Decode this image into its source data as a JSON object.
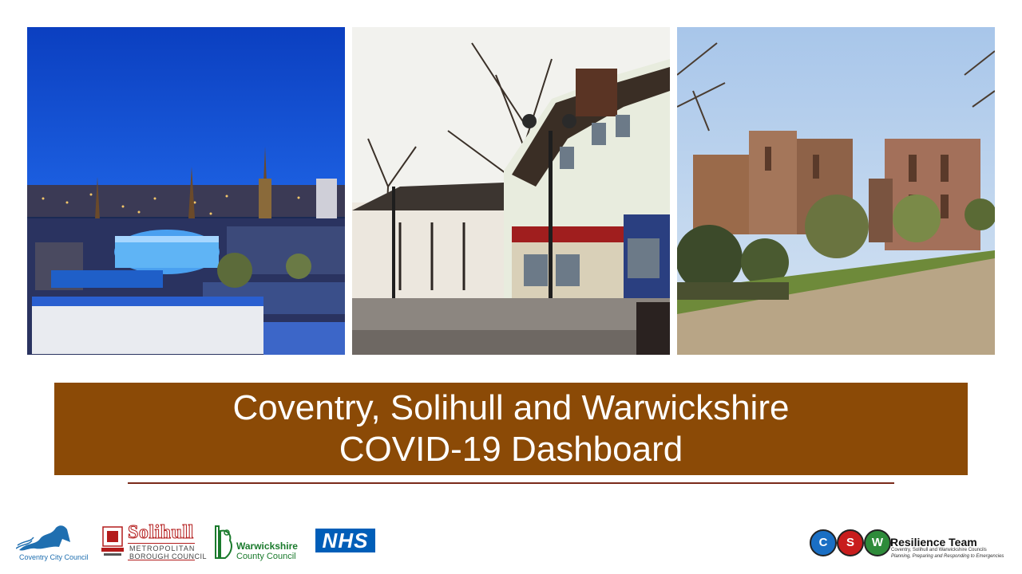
{
  "slide": {
    "title_line1": "Coventry, Solihull and Warwickshire",
    "title_line2": "COVID-19 Dashboard"
  },
  "photos": [
    {
      "subject": "coventry-night-skyline"
    },
    {
      "subject": "solihull-high-street"
    },
    {
      "subject": "kenilworth-castle-ruins"
    }
  ],
  "logos": {
    "coventry": {
      "text": "Coventry City Council"
    },
    "solihull": {
      "name": "Solihull",
      "line1": "METROPOLITAN",
      "line2": "BOROUGH COUNCIL"
    },
    "warwickshire": {
      "line1": "Warwickshire",
      "line2": "County Council"
    },
    "nhs": {
      "text": "NHS"
    },
    "csw": {
      "letters": [
        "C",
        "S",
        "W"
      ],
      "title": "Resilience Team",
      "line1": "Coventry, Solihull and Warwickshire Councils",
      "line2": "Planning, Preparing and Responding to Emergencies"
    }
  },
  "colors": {
    "banner": "#8b4a06",
    "rule": "#7a2a1a",
    "nhs_blue": "#005eb8",
    "csw_c": "#1a6fc4",
    "csw_s": "#c81d1d",
    "csw_w": "#2e8b3a"
  }
}
